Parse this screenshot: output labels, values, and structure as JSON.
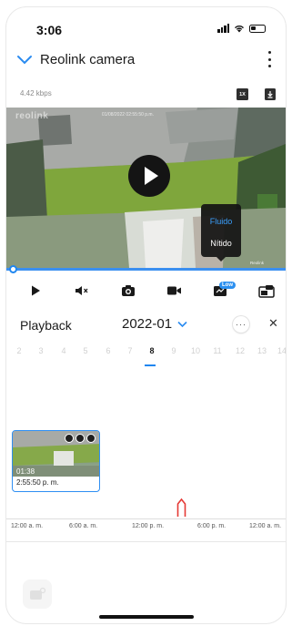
{
  "status_bar": {
    "time": "3:06"
  },
  "header": {
    "title": "Reolink camera",
    "bitrate": "4.42 kbps",
    "speed_label": "1X"
  },
  "video": {
    "watermark": "reolink",
    "osd_timestamp": "01/08/2022 02:55:50 p.m.",
    "osd_camera_name": "Reolink",
    "quality_options": [
      "Fluido",
      "Nítido"
    ],
    "quality_selected": "Fluido",
    "progress": 0.01
  },
  "toolbar": {
    "quality_badge": "Low"
  },
  "playback": {
    "label": "Playback",
    "month": "2022-01",
    "days": [
      "2",
      "3",
      "4",
      "5",
      "6",
      "7",
      "8",
      "9",
      "10",
      "11",
      "12",
      "13",
      "14"
    ],
    "active_day": "8"
  },
  "clip": {
    "duration": "01:38",
    "time": "2:55:50 p. m."
  },
  "timeline": {
    "labels": [
      "12:00 a. m.",
      "6:00 a. m.",
      "12:00 p. m.",
      "6:00 p. m.",
      "12:00 a. m."
    ]
  },
  "colors": {
    "accent": "#1f86f0",
    "recording": "#e53935"
  }
}
